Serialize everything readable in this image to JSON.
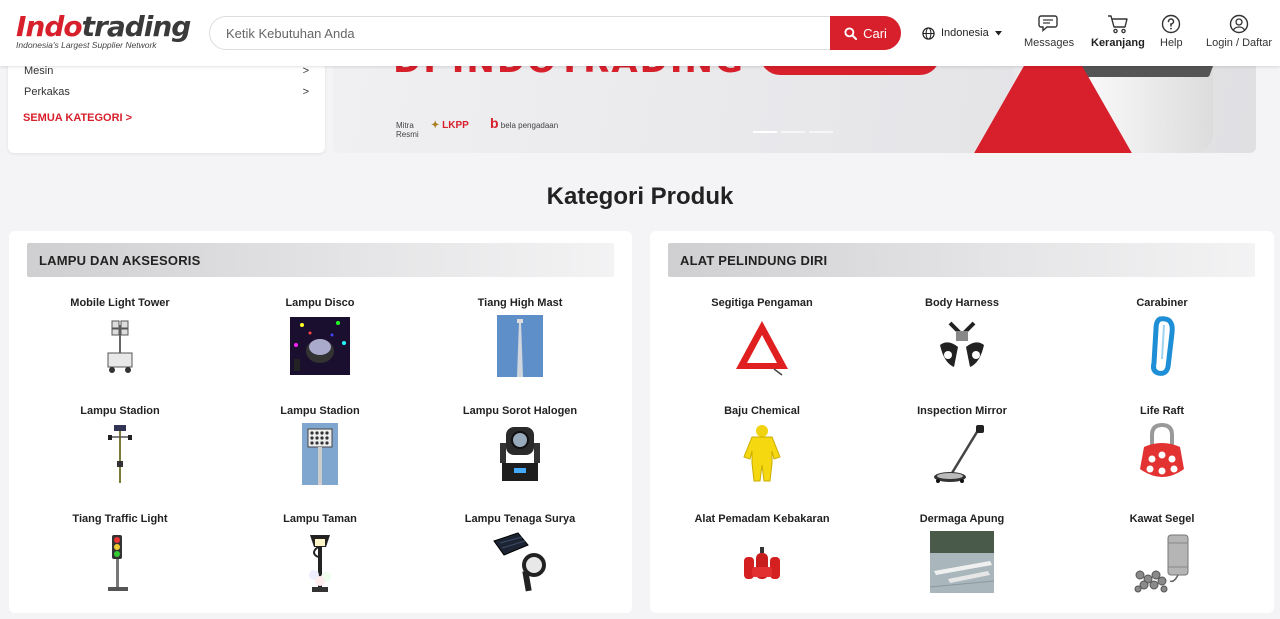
{
  "header": {
    "logo_main_a": "Indo",
    "logo_main_b": "trading",
    "logo_tagline": "Indonesia's Largest Supplier Network",
    "search_placeholder": "Ketik Kebutuhan Anda",
    "search_button": "Cari",
    "language": "Indonesia",
    "messages": "Messages",
    "cart": "Keranjang",
    "help": "Help",
    "login": "Login / Daftar"
  },
  "category_menu": {
    "items": [
      {
        "label": "Mesin",
        "arrow": ">"
      },
      {
        "label": "Perkakas",
        "arrow": ">"
      }
    ],
    "all_link": "SEMUA KATEGORI >"
  },
  "banner": {
    "headline_partial": "DI INDOTRADING",
    "mitra": "Mitra Resmi",
    "lkpp": "LKPP",
    "bela": "bela pengadaan"
  },
  "section_title": "Kategori Produk",
  "cards": [
    {
      "title": "LAMPU DAN AKSESORIS",
      "items": [
        {
          "label": "Mobile Light Tower",
          "icon": "mobile-light-tower-image"
        },
        {
          "label": "Lampu Disco",
          "icon": "disco-light-image"
        },
        {
          "label": "Tiang High Mast",
          "icon": "high-mast-pole-image"
        },
        {
          "label": "Lampu Stadion",
          "icon": "stadium-light-pole-image"
        },
        {
          "label": "Lampu Stadion",
          "icon": "stadium-floodlight-image"
        },
        {
          "label": "Lampu Sorot Halogen",
          "icon": "moving-head-light-image"
        },
        {
          "label": "Tiang Traffic Light",
          "icon": "traffic-light-image"
        },
        {
          "label": "Lampu Taman",
          "icon": "garden-lamp-image"
        },
        {
          "label": "Lampu Tenaga Surya",
          "icon": "solar-lamp-image"
        }
      ]
    },
    {
      "title": "ALAT PELINDUNG DIRI",
      "items": [
        {
          "label": "Segitiga Pengaman",
          "icon": "warning-triangle-image"
        },
        {
          "label": "Body Harness",
          "icon": "body-harness-image"
        },
        {
          "label": "Carabiner",
          "icon": "carabiner-image"
        },
        {
          "label": "Baju Chemical",
          "icon": "chemical-suit-image"
        },
        {
          "label": "Inspection Mirror",
          "icon": "inspection-mirror-image"
        },
        {
          "label": "Life Raft",
          "icon": "lockout-hasp-image"
        },
        {
          "label": "Alat Pemadam Kebakaran",
          "icon": "fire-extinguisher-image"
        },
        {
          "label": "Dermaga Apung",
          "icon": "floating-dock-image"
        },
        {
          "label": "Kawat Segel",
          "icon": "seal-wire-image"
        }
      ]
    }
  ],
  "colors": {
    "brand_red": "#d7202b",
    "page_bg": "#f4f4f6"
  }
}
